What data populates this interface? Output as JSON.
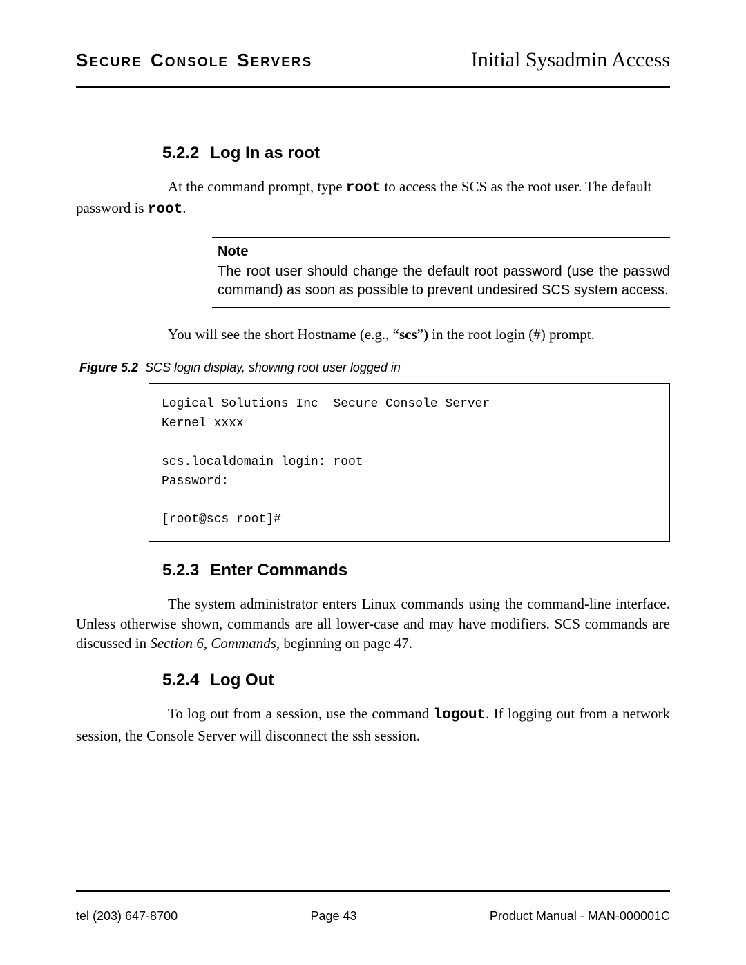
{
  "header": {
    "left_word1": "Secure",
    "left_word2": "Console",
    "left_word3": "Servers",
    "right": "Initial Sysadmin Access"
  },
  "sections": {
    "s522": {
      "number": "5.2.2",
      "title": "Log In as root",
      "para1_a": "At the command prompt, type ",
      "para1_code1": "root",
      "para1_b": " to access the SCS as the root user. The default password is ",
      "para1_code2": "root",
      "para1_c": ".",
      "hostname_para_a": "You will see the short Hostname (e.g., “",
      "hostname_bold": "scs",
      "hostname_para_b": "”) in the root login (#) prompt."
    },
    "note": {
      "title": "Note",
      "body": "The root user should change the default root password (use the passwd command) as soon as possible to prevent undesired SCS system access."
    },
    "figure": {
      "label": "Figure 5.2",
      "caption": "SCS login display, showing root user logged in",
      "console": "Logical Solutions Inc  Secure Console Server\nKernel xxxx\n\nscs.localdomain login: root\nPassword:\n\n[root@scs root]#"
    },
    "s523": {
      "number": "5.2.3",
      "title": "Enter Commands",
      "para_a": "The system administrator enters Linux commands using the command-line interface. Unless otherwise shown, commands are all lower-case and may have modifiers. SCS commands are discussed in ",
      "para_italic": "Section 6, Commands,",
      "para_b": " beginning on page 47."
    },
    "s524": {
      "number": "5.2.4",
      "title": "Log Out",
      "para_a": "To log out from a session, use the command ",
      "para_code": "logout",
      "para_b": ". If logging out from a network session, the Console Server will disconnect the ssh session."
    }
  },
  "footer": {
    "left": "tel (203) 647-8700",
    "center": "Page 43",
    "right": "Product Manual - MAN-000001C"
  }
}
